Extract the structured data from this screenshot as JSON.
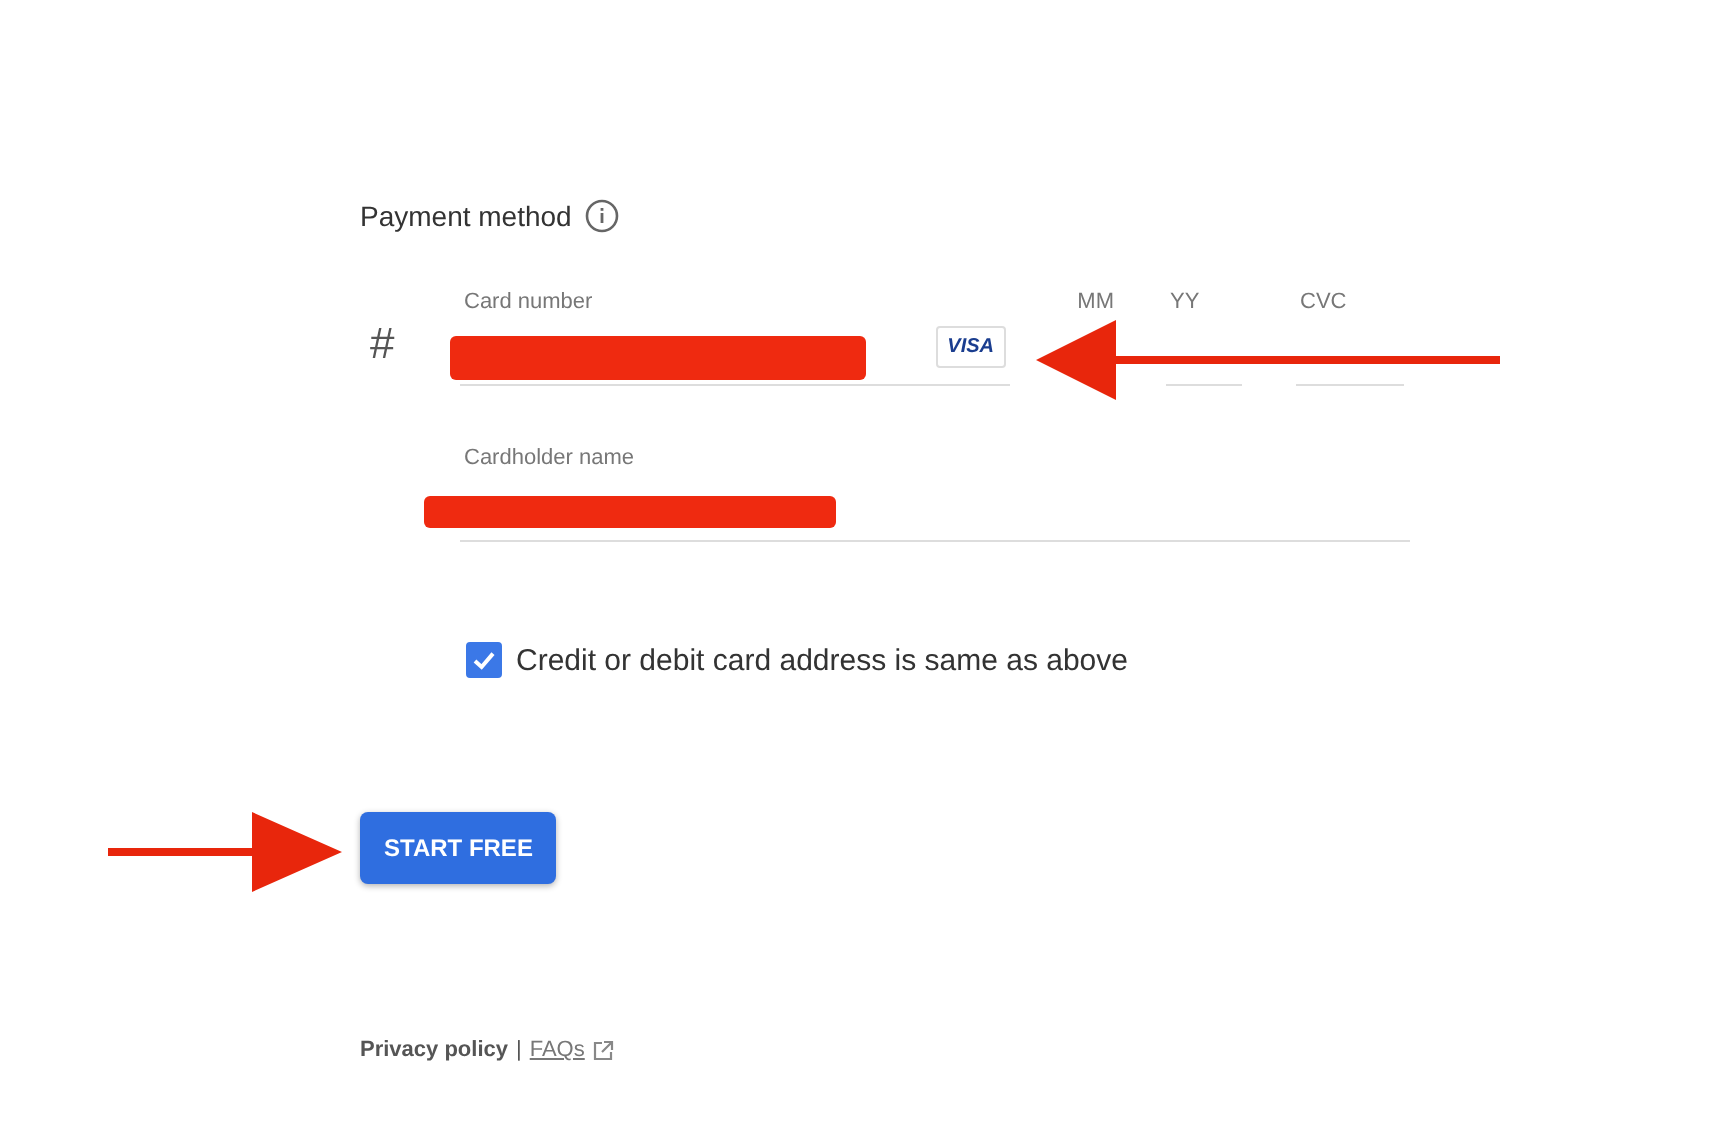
{
  "heading": "Payment method",
  "card": {
    "prefix": "#",
    "number_label": "Card number",
    "brand": "VISA",
    "month_label": "MM",
    "year_label": "YY",
    "cvc_label": "CVC"
  },
  "cardholder": {
    "label": "Cardholder name"
  },
  "address_same": {
    "label": "Credit or debit card address is same as above",
    "checked": true
  },
  "button": "START FREE",
  "footer": {
    "privacy": "Privacy policy",
    "separator": "|",
    "faqs": "FAQs"
  }
}
